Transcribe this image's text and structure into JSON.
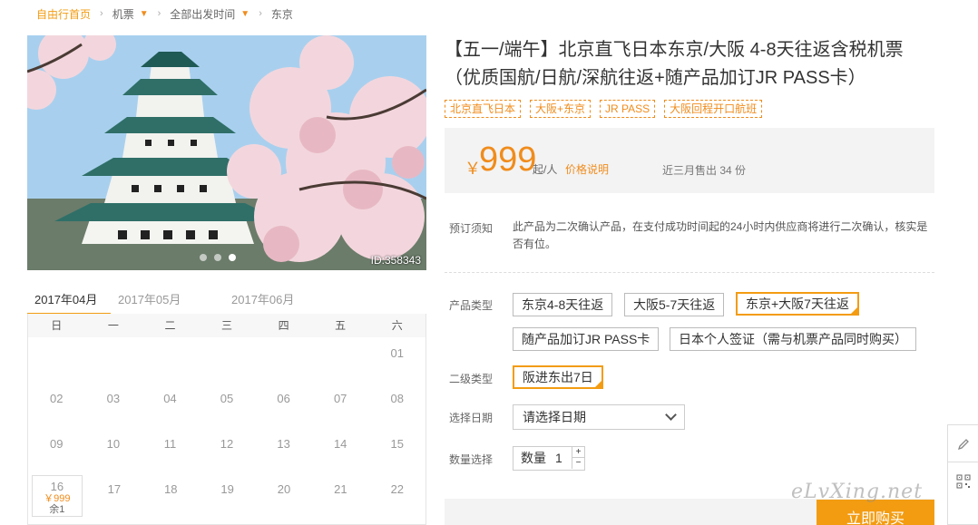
{
  "breadcrumb": {
    "home": "自由行首页",
    "items": [
      "机票",
      "全部出发时间",
      "东京"
    ]
  },
  "hero": {
    "id_label": "ID:358343"
  },
  "calendar": {
    "months": [
      "2017年04月",
      "2017年05月",
      "2017年06月"
    ],
    "active_month": "2017年04月",
    "weekdays": [
      "日",
      "一",
      "二",
      "三",
      "四",
      "五",
      "六"
    ],
    "rows": [
      [
        "",
        "",
        "",
        "",
        "",
        "",
        "01"
      ],
      [
        "02",
        "03",
        "04",
        "05",
        "06",
        "07",
        "08"
      ],
      [
        "09",
        "10",
        "11",
        "12",
        "13",
        "14",
        "15"
      ],
      [
        "16",
        "17",
        "18",
        "19",
        "20",
        "21",
        "22"
      ]
    ],
    "available": {
      "day": "16",
      "price": "￥999",
      "left": "余1"
    }
  },
  "product": {
    "title": "【五一/端午】北京直飞日本东京/大阪 4-8天往返含税机票（优质国航/日航/深航往返+随产品加订JR PASS卡）",
    "tags": [
      "北京直飞日本",
      "大阪+东京",
      "JR PASS",
      "大阪回程开口航班"
    ],
    "price": {
      "currency": "￥",
      "amount": "999",
      "unit": "起/人",
      "explain": "价格说明",
      "sold": "近三月售出 34 份"
    },
    "notice": {
      "label": "预订须知",
      "text": "此产品为二次确认产品，在支付成功时间起的24小时内供应商将进行二次确认，核实是否有位。"
    },
    "type_label": "产品类型",
    "types": [
      "东京4-8天往返",
      "大阪5-7天往返",
      "东京+大阪7天往返",
      "随产品加订JR PASS卡",
      "日本个人签证（需与机票产品同时购买）"
    ],
    "selected_type": "东京+大阪7天往返",
    "subtype_label": "二级类型",
    "subtype": "阪进东出7日",
    "date_label": "选择日期",
    "date_placeholder": "请选择日期",
    "qty_label": "数量选择",
    "qty_prefix": "数量",
    "qty_value": "1",
    "buy_label": "立即购买"
  },
  "watermark": "eLvXing.net",
  "colors": {
    "accent": "#f39c12",
    "price": "#f08c1c"
  }
}
